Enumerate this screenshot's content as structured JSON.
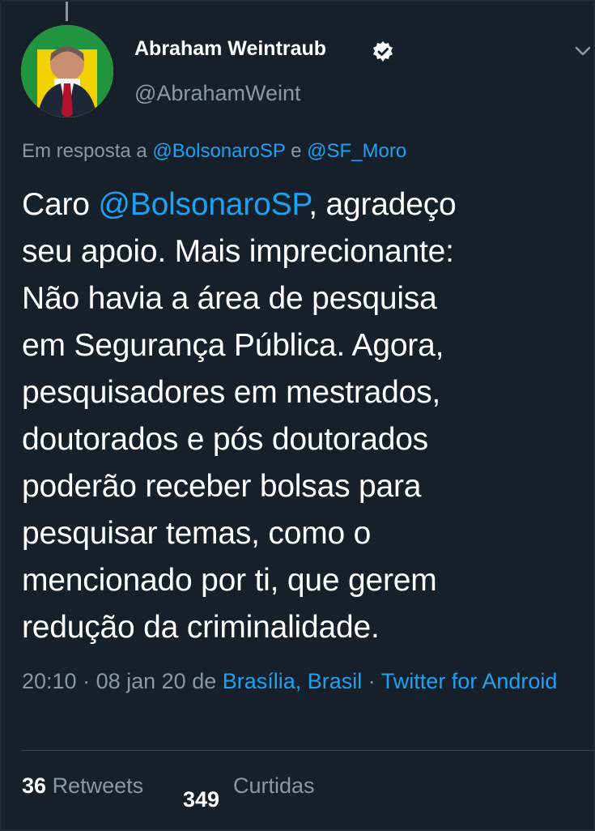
{
  "author": {
    "name": "Abraham Weintraub",
    "handle": "@AbrahamWeint",
    "verified": true
  },
  "reply": {
    "prefix": "Em resposta a",
    "mention_1": "@BolsonaroSP",
    "joiner": "e",
    "mention_2": "@SF_Moro"
  },
  "tweet": {
    "line_1_prefix": "Caro ",
    "line_1_mention": "@BolsonaroSP",
    "line_1_suffix": ", agradeço",
    "line_2": "seu apoio. Mais imprecionante:",
    "line_3": "Não havia a área de pesquisa",
    "line_4": "em Segurança Pública. Agora,",
    "line_5": "pesquisadores em mestrados,",
    "line_6": "doutorados e pós doutorados",
    "line_7": "poderão receber bolsas para",
    "line_8": "pesquisar temas, como o",
    "line_9": "mencionado por ti, que gerem",
    "line_10": "redução da criminalidade."
  },
  "meta": {
    "time": "20:10",
    "separator_1": " · ",
    "date": "08 jan 20",
    "from": " de ",
    "location": "Brasília, Brasil",
    "separator_2": " · ",
    "source": "Twitter for Android"
  },
  "stats": {
    "retweets_count": "36",
    "retweets_label": "Retweets",
    "likes_count": "349",
    "likes_label": "Curtidas"
  },
  "colors": {
    "background": "#15202b",
    "accent": "#1da1f2",
    "secondary_text": "#8899a6"
  },
  "icons": {
    "verified": "verified-badge-icon",
    "menu": "chevron-down-icon"
  }
}
